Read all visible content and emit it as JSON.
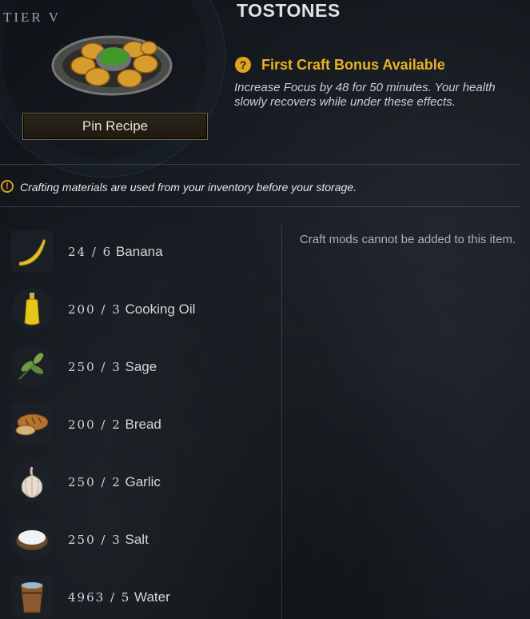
{
  "recipe": {
    "tier_label": "TIER V",
    "title": "TOSTONES",
    "pin_button_label": "Pin Recipe"
  },
  "bonus": {
    "icon": "question-mark-icon",
    "title": "First Craft Bonus Available",
    "description": "Increase Focus by 48 for 50 minutes. Your health slowly recovers while under these effects.",
    "color": "#e8b220"
  },
  "notice": {
    "icon": "exclamation-icon",
    "text": "Crafting materials are used from your inventory before your storage."
  },
  "mods_note": "Craft mods cannot be added to this item.",
  "materials": [
    {
      "count": "24 / 6",
      "name": "Banana",
      "icon": "banana-icon"
    },
    {
      "count": "200 / 3",
      "name": "Cooking Oil",
      "icon": "cooking-oil-icon"
    },
    {
      "count": "250 / 3",
      "name": "Sage",
      "icon": "sage-icon"
    },
    {
      "count": "200 / 2",
      "name": "Bread",
      "icon": "bread-icon"
    },
    {
      "count": "250 / 2",
      "name": "Garlic",
      "icon": "garlic-icon"
    },
    {
      "count": "250 / 3",
      "name": "Salt",
      "icon": "salt-icon"
    },
    {
      "count": "4963 / 5",
      "name": "Water",
      "icon": "water-icon"
    }
  ]
}
